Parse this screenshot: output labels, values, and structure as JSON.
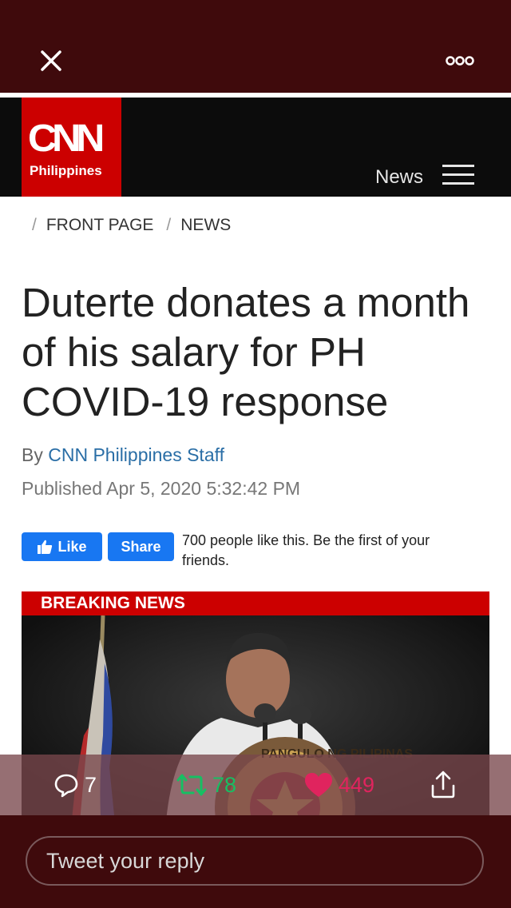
{
  "topbar": {
    "close_icon": "close-icon",
    "more_icon": "more-icon"
  },
  "header": {
    "logo_text": "CNN",
    "logo_sub": "Philippines",
    "nav_label": "News"
  },
  "breadcrumb": {
    "items": [
      "FRONT PAGE",
      "NEWS"
    ]
  },
  "article": {
    "headline": "Duterte donates a month of his salary for PH COVID-19 response",
    "by_prefix": "By",
    "author": "CNN Philippines Staff",
    "published": "Published Apr 5, 2020 5:32:42 PM"
  },
  "facebook": {
    "like_label": "Like",
    "share_label": "Share",
    "social_text": "700 people like this. Be the first of your friends."
  },
  "image": {
    "banner": "BREAKING NEWS",
    "seal_text": "PANGULO NG PILIPINAS"
  },
  "actions": {
    "replies": "7",
    "retweets": "78",
    "likes": "449",
    "colors": {
      "retweet": "#17bf63",
      "like": "#e0245e"
    }
  },
  "reply": {
    "placeholder": "Tweet your reply"
  }
}
